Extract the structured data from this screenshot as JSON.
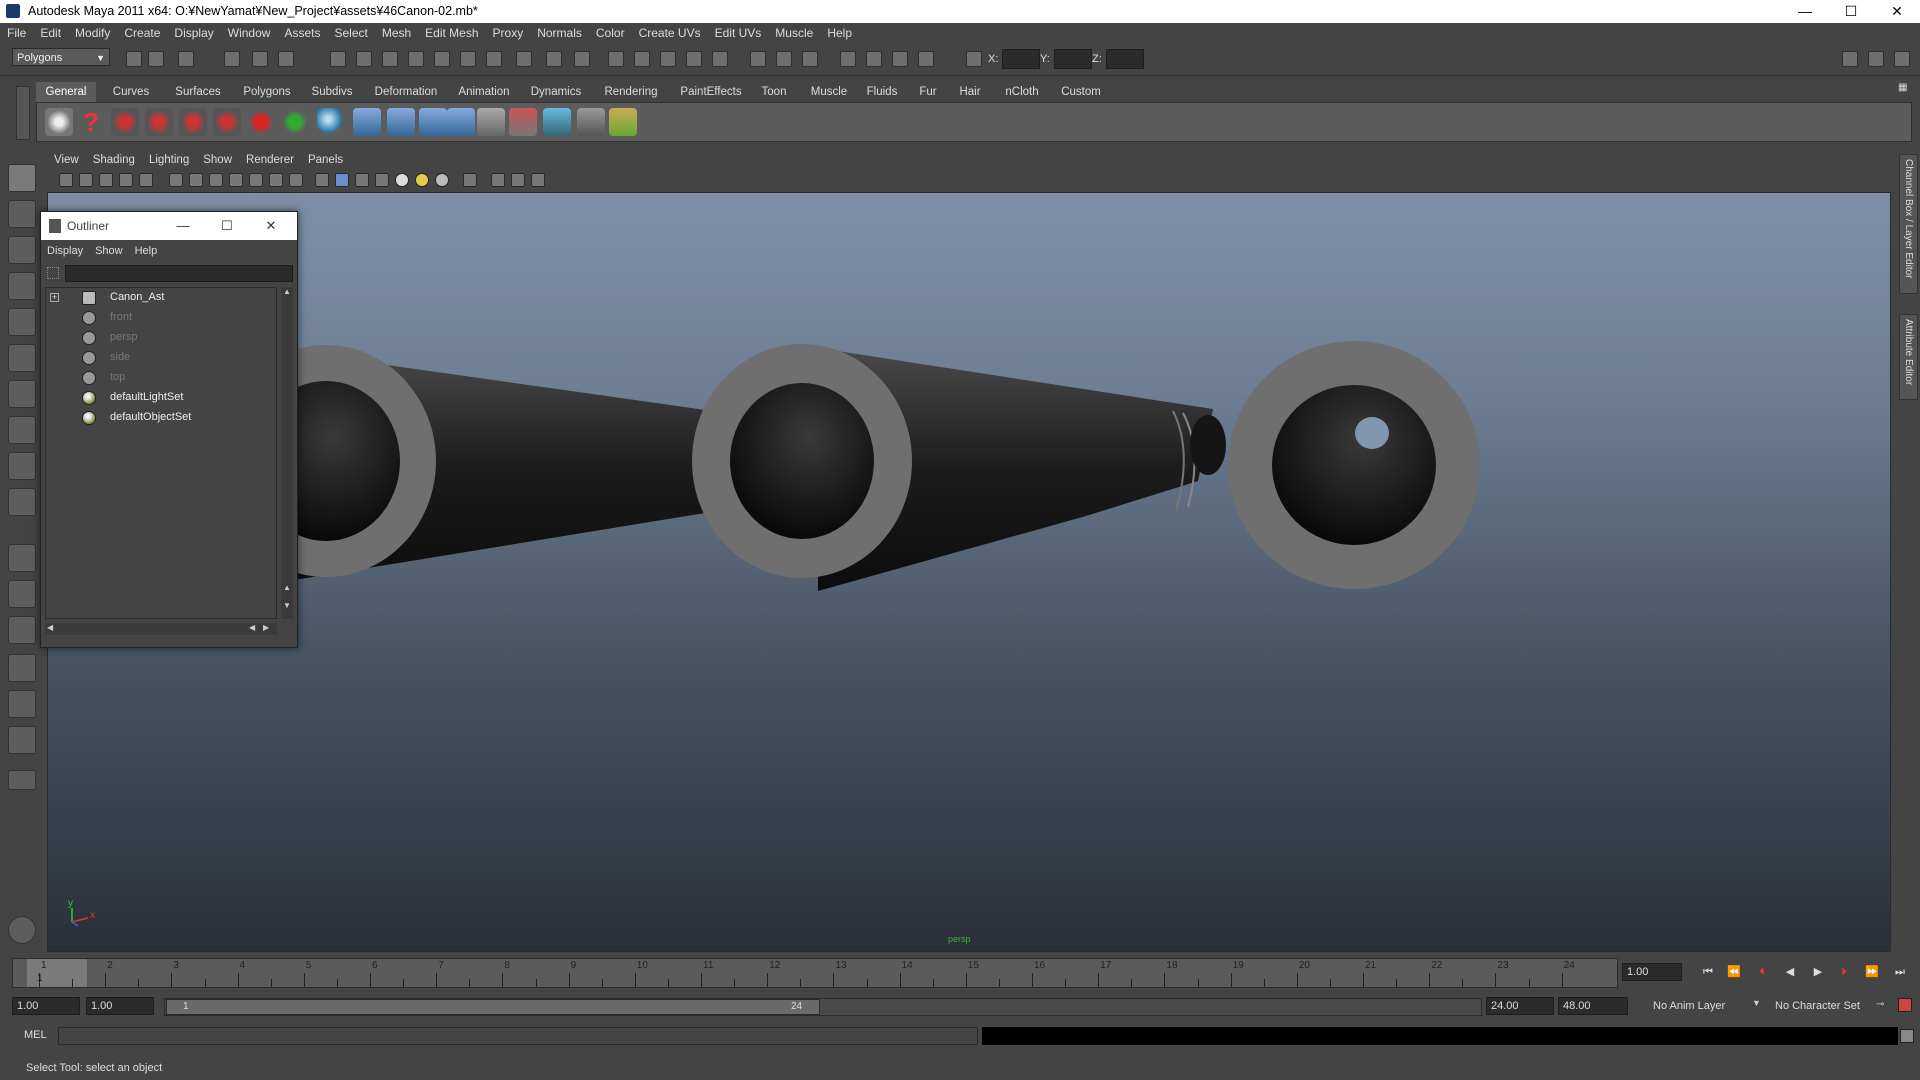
{
  "window": {
    "title": "Autodesk Maya 2011 x64: O:¥NewYamat¥New_Project¥assets¥46Canon-02.mb*",
    "min_glyph": "—",
    "max_glyph": "☐",
    "close_glyph": "✕"
  },
  "menubar": [
    "File",
    "Edit",
    "Modify",
    "Create",
    "Display",
    "Window",
    "Assets",
    "Select",
    "Mesh",
    "Edit Mesh",
    "Proxy",
    "Normals",
    "Color",
    "Create UVs",
    "Edit UVs",
    "Muscle",
    "Help"
  ],
  "statusline": {
    "mode": "Polygons",
    "x_label": "X:",
    "y_label": "Y:",
    "z_label": "Z:"
  },
  "shelf": {
    "tabs": [
      "General",
      "Curves",
      "Surfaces",
      "Polygons",
      "Subdivs",
      "Deformation",
      "Animation",
      "Dynamics",
      "Rendering",
      "PaintEffects",
      "Toon",
      "Muscle",
      "Fluids",
      "Fur",
      "Hair",
      "nCloth",
      "Custom"
    ],
    "active_tab": "General"
  },
  "panel": {
    "menu": [
      "View",
      "Shading",
      "Lighting",
      "Show",
      "Renderer",
      "Panels"
    ],
    "camera_label": "persp",
    "axis_y": "y",
    "axis_x": "x"
  },
  "right_tabs": {
    "channel_box": "Channel Box / Layer Editor",
    "attribute_editor": "Attribute Editor"
  },
  "outliner": {
    "title": "Outliner",
    "menu": [
      "Display",
      "Show",
      "Help"
    ],
    "items": [
      {
        "label": "Canon_Ast",
        "type": "group",
        "dim": false,
        "expandable": true
      },
      {
        "label": "front",
        "type": "camera",
        "dim": true
      },
      {
        "label": "persp",
        "type": "camera",
        "dim": true
      },
      {
        "label": "side",
        "type": "camera",
        "dim": true
      },
      {
        "label": "top",
        "type": "camera",
        "dim": true
      },
      {
        "label": "defaultLightSet",
        "type": "set",
        "dim": false
      },
      {
        "label": "defaultObjectSet",
        "type": "set",
        "dim": false
      }
    ]
  },
  "timeline": {
    "ticks": [
      "1",
      "2",
      "3",
      "4",
      "5",
      "6",
      "7",
      "8",
      "9",
      "10",
      "11",
      "12",
      "13",
      "14",
      "15",
      "16",
      "17",
      "18",
      "19",
      "20",
      "21",
      "22",
      "23",
      "24"
    ],
    "current_marker": "1",
    "current_frame": "1.00"
  },
  "range": {
    "start": "1.00",
    "playback_start": "1.00",
    "slider_start": "1",
    "slider_end": "24",
    "playback_end": "24.00",
    "end": "48.00",
    "anim_layer": "No Anim Layer",
    "character_set": "No Character Set"
  },
  "command": {
    "lang": "MEL"
  },
  "help_line": "Select Tool: select an object"
}
